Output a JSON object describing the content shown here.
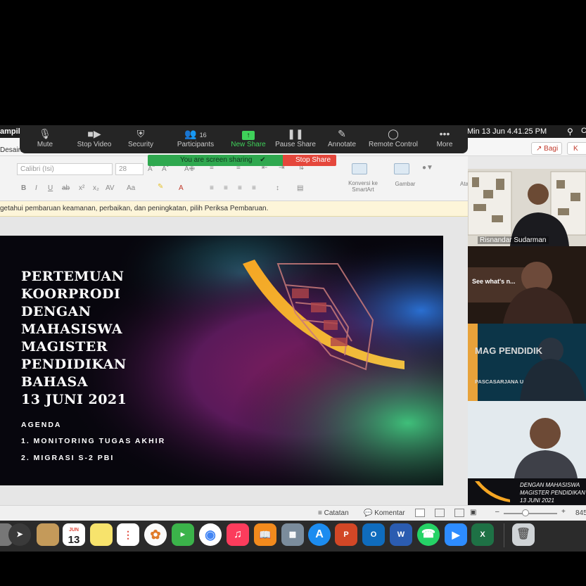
{
  "menubar": {
    "app": "ampili",
    "clock": "Min 13 Jun  4.41.25 PM",
    "search_icon": "search-icon",
    "more": "C"
  },
  "titlerow": {
    "tab": "Desain",
    "share_label": "Bagi",
    "other_label": "K"
  },
  "ribbon": {
    "font_name": "Calibri (Isi)",
    "font_size": "28",
    "convert_label": "Konversi ke SmartArt",
    "picture_label": "Gambar",
    "at_label": "Ata"
  },
  "notification": "getahui pembaruan keamanan, perbaikan, dan peningkatan, pilih Periksa Pembaruan.",
  "slide": {
    "title_lines": [
      "PERTEMUAN",
      "KOORPRODI",
      "DENGAN",
      "MAHASISWA",
      "MAGISTER",
      "PENDIDIKAN",
      "BAHASA",
      "13 JUNI 2021"
    ],
    "agenda_label": "AGENDA",
    "agenda_items": [
      "1.   MONITORING TUGAS AKHIR",
      "2.   MIGRASI S-2 PBI"
    ]
  },
  "statusbar": {
    "notes": "Catatan",
    "comments": "Komentar",
    "zoom": "845"
  },
  "zoom_toolbar": {
    "items": [
      {
        "label": "Mute",
        "icon": "microphone-icon"
      },
      {
        "label": "Stop Video",
        "icon": "video-camera-icon"
      },
      {
        "label": "Security",
        "icon": "shield-icon"
      },
      {
        "label": "Participants",
        "icon": "people-icon",
        "count": "16"
      },
      {
        "label": "New Share",
        "icon": "share-arrow-icon"
      },
      {
        "label": "Pause Share",
        "icon": "pause-icon"
      },
      {
        "label": "Annotate",
        "icon": "pen-icon"
      },
      {
        "label": "Remote Control",
        "icon": "mouse-icon"
      },
      {
        "label": "More",
        "icon": "ellipsis-icon"
      }
    ],
    "sharing_text": "You are screen sharing",
    "stop_share": "Stop Share"
  },
  "participants": [
    {
      "name": "Risnandar Sudarman"
    },
    {
      "overlay": "See what's n..."
    },
    {
      "overlay": "MAG PENDIDIK",
      "sub": "PASCASARJANA U"
    },
    {
      "caption_lines": [
        "DENGAN MAHASISWA",
        "MAGISTER PENDIDIKAN B",
        "13 JUNI 2021"
      ]
    }
  ],
  "dock": {
    "calendar_month": "JUN",
    "calendar_day": "13"
  },
  "colors": {
    "zoom_green": "#2fa84f",
    "stop_red": "#e5473c",
    "toolbar": "#252525",
    "accent_green": "#3fd15a"
  }
}
